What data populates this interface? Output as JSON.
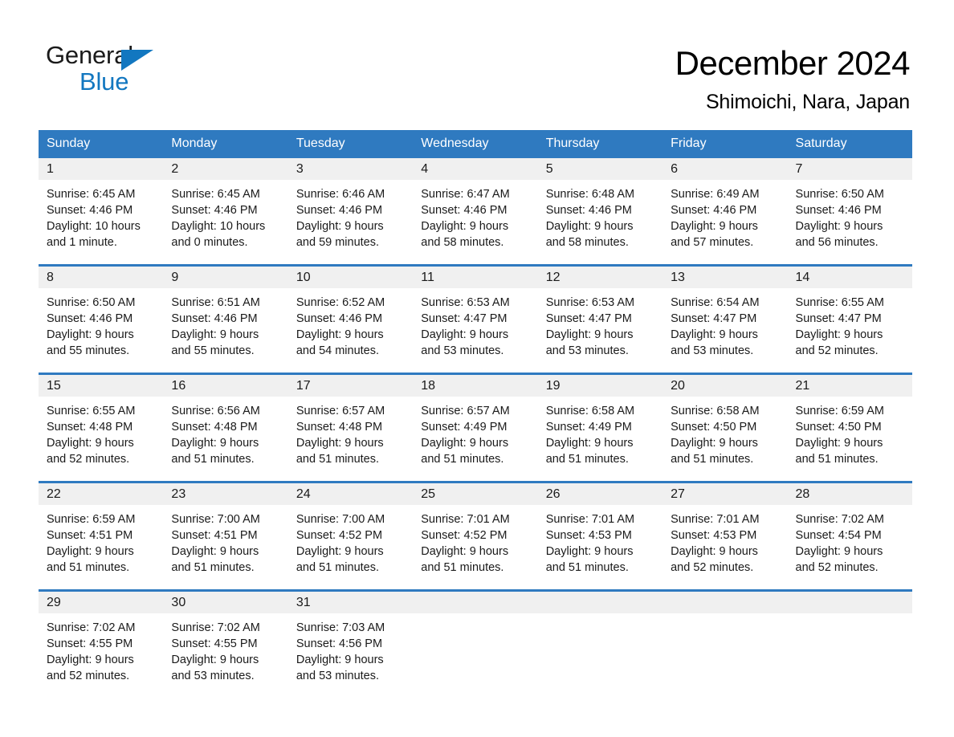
{
  "brand": {
    "name_part1": "General",
    "name_part2": "Blue",
    "accent_color": "#1277c0"
  },
  "header": {
    "month_title": "December 2024",
    "location": "Shimoichi, Nara, Japan"
  },
  "calendar": {
    "header_color": "#2f7ac0",
    "day_band_color": "#f0f0f0",
    "weekdays": [
      "Sunday",
      "Monday",
      "Tuesday",
      "Wednesday",
      "Thursday",
      "Friday",
      "Saturday"
    ],
    "weeks": [
      {
        "days": [
          {
            "date": "1",
            "sunrise": "Sunrise: 6:45 AM",
            "sunset": "Sunset: 4:46 PM",
            "daylight1": "Daylight: 10 hours",
            "daylight2": "and 1 minute."
          },
          {
            "date": "2",
            "sunrise": "Sunrise: 6:45 AM",
            "sunset": "Sunset: 4:46 PM",
            "daylight1": "Daylight: 10 hours",
            "daylight2": "and 0 minutes."
          },
          {
            "date": "3",
            "sunrise": "Sunrise: 6:46 AM",
            "sunset": "Sunset: 4:46 PM",
            "daylight1": "Daylight: 9 hours",
            "daylight2": "and 59 minutes."
          },
          {
            "date": "4",
            "sunrise": "Sunrise: 6:47 AM",
            "sunset": "Sunset: 4:46 PM",
            "daylight1": "Daylight: 9 hours",
            "daylight2": "and 58 minutes."
          },
          {
            "date": "5",
            "sunrise": "Sunrise: 6:48 AM",
            "sunset": "Sunset: 4:46 PM",
            "daylight1": "Daylight: 9 hours",
            "daylight2": "and 58 minutes."
          },
          {
            "date": "6",
            "sunrise": "Sunrise: 6:49 AM",
            "sunset": "Sunset: 4:46 PM",
            "daylight1": "Daylight: 9 hours",
            "daylight2": "and 57 minutes."
          },
          {
            "date": "7",
            "sunrise": "Sunrise: 6:50 AM",
            "sunset": "Sunset: 4:46 PM",
            "daylight1": "Daylight: 9 hours",
            "daylight2": "and 56 minutes."
          }
        ]
      },
      {
        "days": [
          {
            "date": "8",
            "sunrise": "Sunrise: 6:50 AM",
            "sunset": "Sunset: 4:46 PM",
            "daylight1": "Daylight: 9 hours",
            "daylight2": "and 55 minutes."
          },
          {
            "date": "9",
            "sunrise": "Sunrise: 6:51 AM",
            "sunset": "Sunset: 4:46 PM",
            "daylight1": "Daylight: 9 hours",
            "daylight2": "and 55 minutes."
          },
          {
            "date": "10",
            "sunrise": "Sunrise: 6:52 AM",
            "sunset": "Sunset: 4:46 PM",
            "daylight1": "Daylight: 9 hours",
            "daylight2": "and 54 minutes."
          },
          {
            "date": "11",
            "sunrise": "Sunrise: 6:53 AM",
            "sunset": "Sunset: 4:47 PM",
            "daylight1": "Daylight: 9 hours",
            "daylight2": "and 53 minutes."
          },
          {
            "date": "12",
            "sunrise": "Sunrise: 6:53 AM",
            "sunset": "Sunset: 4:47 PM",
            "daylight1": "Daylight: 9 hours",
            "daylight2": "and 53 minutes."
          },
          {
            "date": "13",
            "sunrise": "Sunrise: 6:54 AM",
            "sunset": "Sunset: 4:47 PM",
            "daylight1": "Daylight: 9 hours",
            "daylight2": "and 53 minutes."
          },
          {
            "date": "14",
            "sunrise": "Sunrise: 6:55 AM",
            "sunset": "Sunset: 4:47 PM",
            "daylight1": "Daylight: 9 hours",
            "daylight2": "and 52 minutes."
          }
        ]
      },
      {
        "days": [
          {
            "date": "15",
            "sunrise": "Sunrise: 6:55 AM",
            "sunset": "Sunset: 4:48 PM",
            "daylight1": "Daylight: 9 hours",
            "daylight2": "and 52 minutes."
          },
          {
            "date": "16",
            "sunrise": "Sunrise: 6:56 AM",
            "sunset": "Sunset: 4:48 PM",
            "daylight1": "Daylight: 9 hours",
            "daylight2": "and 51 minutes."
          },
          {
            "date": "17",
            "sunrise": "Sunrise: 6:57 AM",
            "sunset": "Sunset: 4:48 PM",
            "daylight1": "Daylight: 9 hours",
            "daylight2": "and 51 minutes."
          },
          {
            "date": "18",
            "sunrise": "Sunrise: 6:57 AM",
            "sunset": "Sunset: 4:49 PM",
            "daylight1": "Daylight: 9 hours",
            "daylight2": "and 51 minutes."
          },
          {
            "date": "19",
            "sunrise": "Sunrise: 6:58 AM",
            "sunset": "Sunset: 4:49 PM",
            "daylight1": "Daylight: 9 hours",
            "daylight2": "and 51 minutes."
          },
          {
            "date": "20",
            "sunrise": "Sunrise: 6:58 AM",
            "sunset": "Sunset: 4:50 PM",
            "daylight1": "Daylight: 9 hours",
            "daylight2": "and 51 minutes."
          },
          {
            "date": "21",
            "sunrise": "Sunrise: 6:59 AM",
            "sunset": "Sunset: 4:50 PM",
            "daylight1": "Daylight: 9 hours",
            "daylight2": "and 51 minutes."
          }
        ]
      },
      {
        "days": [
          {
            "date": "22",
            "sunrise": "Sunrise: 6:59 AM",
            "sunset": "Sunset: 4:51 PM",
            "daylight1": "Daylight: 9 hours",
            "daylight2": "and 51 minutes."
          },
          {
            "date": "23",
            "sunrise": "Sunrise: 7:00 AM",
            "sunset": "Sunset: 4:51 PM",
            "daylight1": "Daylight: 9 hours",
            "daylight2": "and 51 minutes."
          },
          {
            "date": "24",
            "sunrise": "Sunrise: 7:00 AM",
            "sunset": "Sunset: 4:52 PM",
            "daylight1": "Daylight: 9 hours",
            "daylight2": "and 51 minutes."
          },
          {
            "date": "25",
            "sunrise": "Sunrise: 7:01 AM",
            "sunset": "Sunset: 4:52 PM",
            "daylight1": "Daylight: 9 hours",
            "daylight2": "and 51 minutes."
          },
          {
            "date": "26",
            "sunrise": "Sunrise: 7:01 AM",
            "sunset": "Sunset: 4:53 PM",
            "daylight1": "Daylight: 9 hours",
            "daylight2": "and 51 minutes."
          },
          {
            "date": "27",
            "sunrise": "Sunrise: 7:01 AM",
            "sunset": "Sunset: 4:53 PM",
            "daylight1": "Daylight: 9 hours",
            "daylight2": "and 52 minutes."
          },
          {
            "date": "28",
            "sunrise": "Sunrise: 7:02 AM",
            "sunset": "Sunset: 4:54 PM",
            "daylight1": "Daylight: 9 hours",
            "daylight2": "and 52 minutes."
          }
        ]
      },
      {
        "days": [
          {
            "date": "29",
            "sunrise": "Sunrise: 7:02 AM",
            "sunset": "Sunset: 4:55 PM",
            "daylight1": "Daylight: 9 hours",
            "daylight2": "and 52 minutes."
          },
          {
            "date": "30",
            "sunrise": "Sunrise: 7:02 AM",
            "sunset": "Sunset: 4:55 PM",
            "daylight1": "Daylight: 9 hours",
            "daylight2": "and 53 minutes."
          },
          {
            "date": "31",
            "sunrise": "Sunrise: 7:03 AM",
            "sunset": "Sunset: 4:56 PM",
            "daylight1": "Daylight: 9 hours",
            "daylight2": "and 53 minutes."
          },
          {
            "date": "",
            "sunrise": "",
            "sunset": "",
            "daylight1": "",
            "daylight2": ""
          },
          {
            "date": "",
            "sunrise": "",
            "sunset": "",
            "daylight1": "",
            "daylight2": ""
          },
          {
            "date": "",
            "sunrise": "",
            "sunset": "",
            "daylight1": "",
            "daylight2": ""
          },
          {
            "date": "",
            "sunrise": "",
            "sunset": "",
            "daylight1": "",
            "daylight2": ""
          }
        ]
      }
    ]
  }
}
